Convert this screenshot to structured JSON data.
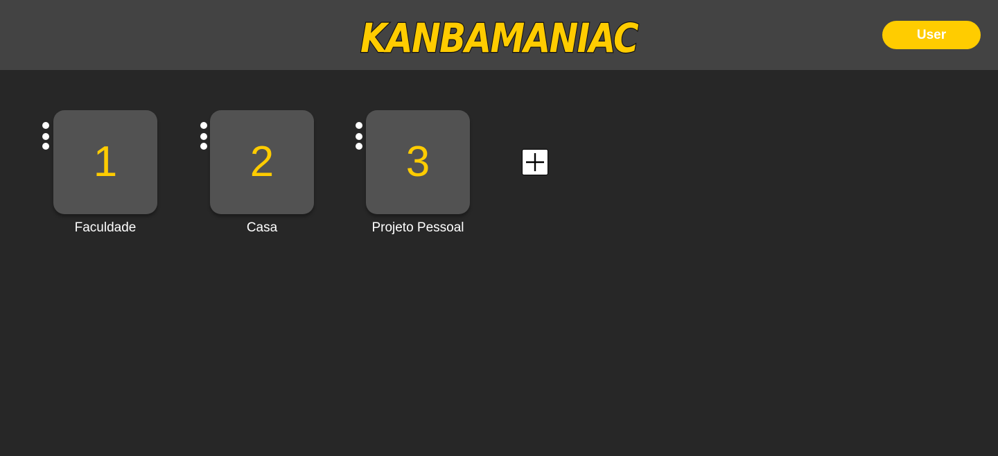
{
  "header": {
    "logo_text": "KANBAMANIAC",
    "user_button_label": "User",
    "brand_color": "#FFCC00"
  },
  "boards": [
    {
      "number": "1",
      "label": "Faculdade"
    },
    {
      "number": "2",
      "label": "Casa"
    },
    {
      "number": "3",
      "label": "Projeto Pessoal"
    }
  ],
  "icons": {
    "board_menu": "vertical-dots-icon",
    "add_board": "plus-icon"
  }
}
